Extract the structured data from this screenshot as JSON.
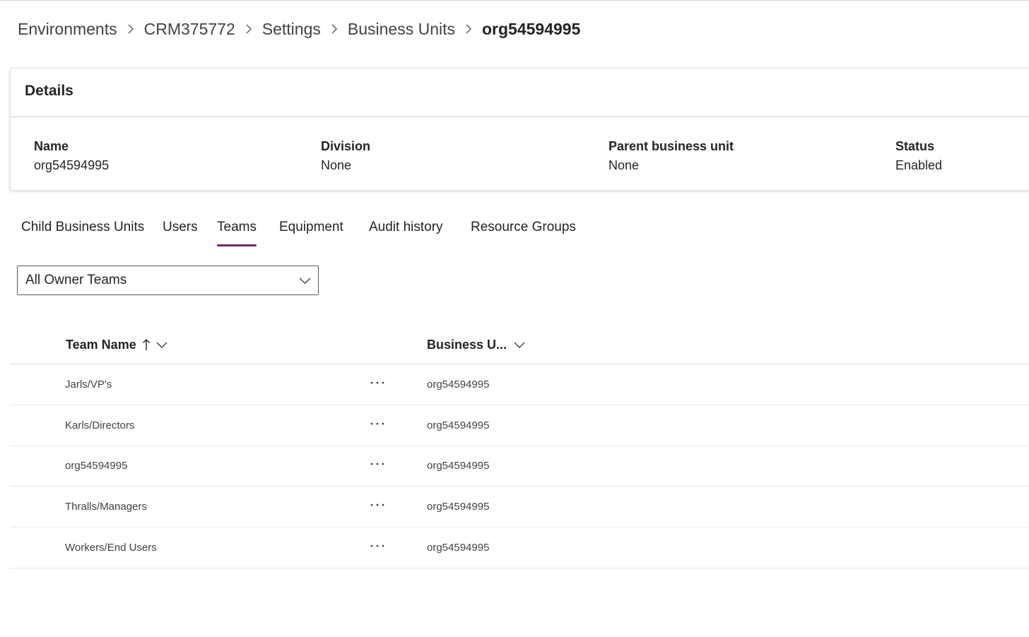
{
  "breadcrumb": {
    "items": [
      "Environments",
      "CRM375772",
      "Settings",
      "Business Units"
    ],
    "current": "org54594995"
  },
  "details": {
    "title": "Details",
    "fields": [
      {
        "label": "Name",
        "value": "org54594995"
      },
      {
        "label": "Division",
        "value": "None"
      },
      {
        "label": "Parent business unit",
        "value": "None"
      },
      {
        "label": "Status",
        "value": "Enabled"
      }
    ]
  },
  "tabs": {
    "items": [
      "Child Business Units",
      "Users",
      "Teams",
      "Equipment",
      "Audit history",
      "Resource Groups"
    ],
    "active": "Teams"
  },
  "filter": {
    "selected": "All Owner Teams"
  },
  "grid": {
    "columns": {
      "team_name": "Team Name",
      "business_unit": "Business U..."
    },
    "rows": [
      {
        "team_name": "Jarls/VP's",
        "business_unit": "org54594995"
      },
      {
        "team_name": "Karls/Directors",
        "business_unit": "org54594995"
      },
      {
        "team_name": "org54594995",
        "business_unit": "org54594995"
      },
      {
        "team_name": "Thralls/Managers",
        "business_unit": "org54594995"
      },
      {
        "team_name": "Workers/End Users",
        "business_unit": "org54594995"
      }
    ]
  },
  "colors": {
    "accent": "#742774",
    "text": "#242424"
  }
}
